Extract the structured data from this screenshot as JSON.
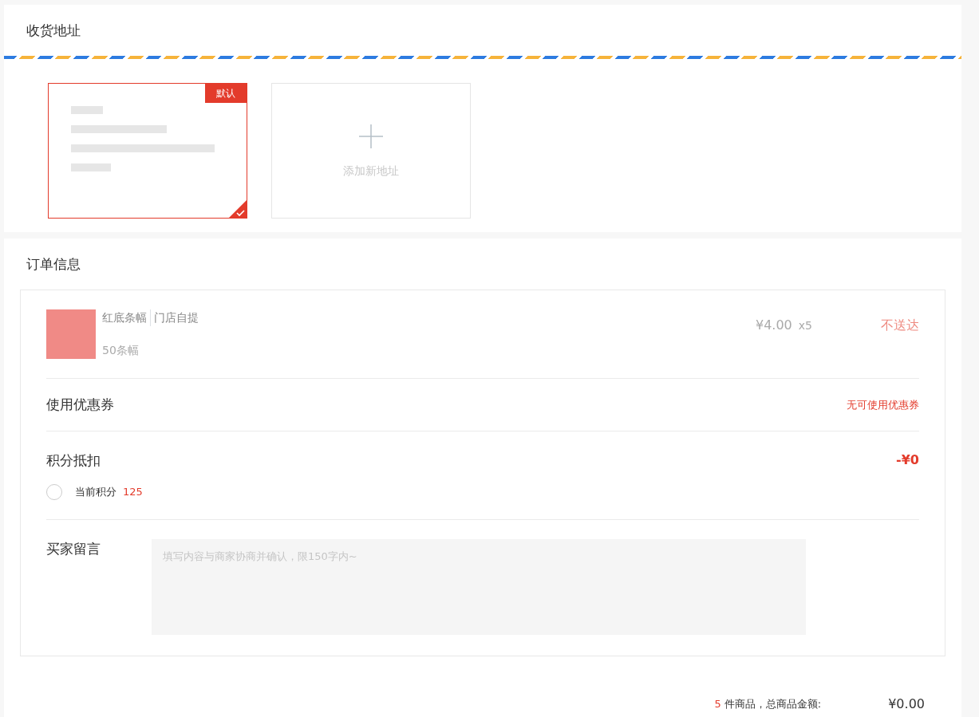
{
  "address_section": {
    "title": "收货地址",
    "addresses": [
      {
        "default_badge": "默认",
        "selected": true
      }
    ],
    "add_button": {
      "label": "添加新地址"
    }
  },
  "order_section": {
    "title": "订单信息",
    "product": {
      "name": "红底条幅",
      "delivery": "门店自提",
      "spec": "50条幅",
      "price": "¥4.00",
      "quantity": "x5",
      "status": "不送达"
    },
    "coupon": {
      "label": "使用优惠券",
      "value": "无可使用优惠券"
    },
    "points": {
      "label": "积分抵扣",
      "amount": "-¥0",
      "option_label": "当前积分",
      "option_value": "125",
      "checked": false
    },
    "message": {
      "label": "买家留言",
      "placeholder": "填写内容与商家协商并确认，限150字内~"
    }
  },
  "summary": {
    "count": "5",
    "text": "件商品，总商品金额:",
    "total": "¥0.00"
  }
}
